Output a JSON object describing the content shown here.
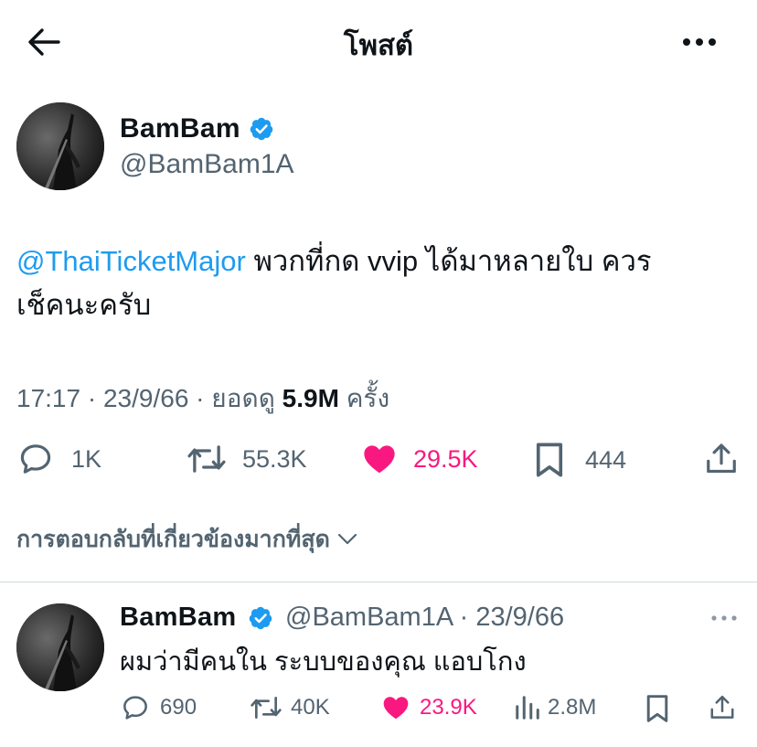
{
  "header": {
    "title": "โพสต์",
    "back_icon": "arrow-left-icon",
    "more_icon": "more-horizontal-icon"
  },
  "tweet": {
    "author_name": "BamBam",
    "author_handle": "@BamBam1A",
    "mention": "@ThaiTicketMajor",
    "text_line1": " พวกที่กด vvip ได้มาหลายใบ ควร",
    "text_line2": "เช็คนะครับ",
    "time": "17:17",
    "date": "23/9/66",
    "views_label": "ยอดดู",
    "views_value": "5.9M",
    "views_unit": "ครั้ง",
    "replies": "1K",
    "retweets": "55.3K",
    "likes": "29.5K",
    "bookmarks": "444"
  },
  "sort": {
    "label": "การตอบกลับที่เกี่ยวข้องมากที่สุด"
  },
  "reply": {
    "author_name": "BamBam",
    "author_handle": "@BamBam1A",
    "date": "23/9/66",
    "text": "ผมว่ามีคนใน ระบบของคุณ แอบโกง",
    "replies": "690",
    "retweets": "40K",
    "likes": "23.9K",
    "views": "2.8M"
  },
  "colors": {
    "accent": "#1d9bf0",
    "like": "#f91880",
    "muted": "#536471",
    "text": "#0f1419"
  }
}
